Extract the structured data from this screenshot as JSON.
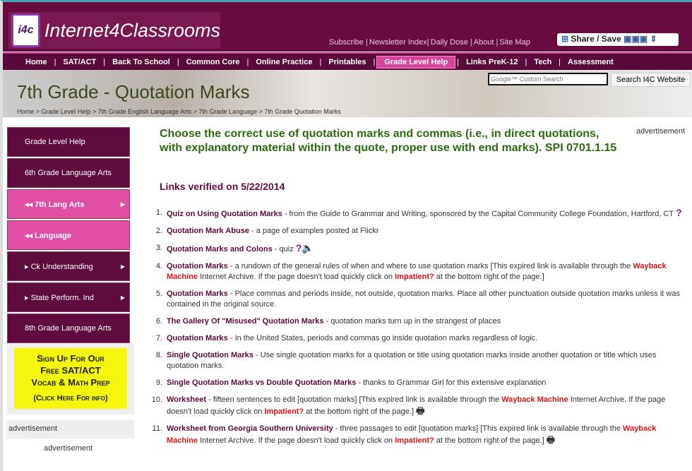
{
  "header": {
    "logo_badge": "i4c",
    "logo_text": "Internet4Classrooms",
    "top_links": [
      "Subscribe |",
      "Newsletter Index|",
      "Daily Dose |",
      "About |",
      "Site Map"
    ],
    "share_label": "Share / Save"
  },
  "nav": [
    {
      "label": "Home"
    },
    {
      "label": "SAT/ACT"
    },
    {
      "label": "Back To School"
    },
    {
      "label": "Common Core"
    },
    {
      "label": "Online Practice"
    },
    {
      "label": "Printables"
    },
    {
      "label": "Grade Level Help",
      "active": true
    },
    {
      "label": "Links PreK-12"
    },
    {
      "label": "Tech"
    },
    {
      "label": "Assessment"
    }
  ],
  "banner": {
    "title": "7th Grade - Quotation Marks",
    "breadcrumb": "Home > Grade Level Help > 7th Grade English Language Arts > 7th Grade Language > 7th Grade Quotation Marks",
    "search_placeholder": "Google™ Custom Search",
    "search_button": "Search I4C Website"
  },
  "sidebar": [
    {
      "label": "Grade Level Help"
    },
    {
      "label": "6th Grade Language Arts"
    },
    {
      "label": "◂◂ 7th Lang Arts",
      "pink": true,
      "arrow": true
    },
    {
      "label": "◂◂ Language",
      "pink": true
    },
    {
      "label": "▸  Ck Understanding",
      "arrow": true
    },
    {
      "label": "▸  State Perform. Ind",
      "arrow": true
    },
    {
      "label": "8th Grade Language Arts"
    }
  ],
  "promo": {
    "line1": "Sign Up For Our",
    "line2": "Free SAT/ACT",
    "line3": "Vocab & Math Prep",
    "line4": "(Click Here For info)"
  },
  "ads": {
    "a1": "advertisement",
    "a2": "advertisement",
    "a3": "advertisement"
  },
  "main": {
    "heading": "Choose the correct use of quotation marks and commas (i.e., in direct quotations, with explanatory material within the quote, proper use with end marks). SPI 0701.1.15",
    "verified": "Links verified on 5/22/2014",
    "items": [
      {
        "num": "1.",
        "parts": [
          {
            "t": "lk",
            "v": "Quiz on Using Quotation Marks"
          },
          {
            "t": "txt",
            "v": " - from the Guide to Grammar and Writing, sponsored by the Capital Community College Foundation, Hartford, CT "
          },
          {
            "t": "q",
            "v": "?"
          }
        ]
      },
      {
        "num": "2.",
        "parts": [
          {
            "t": "lk",
            "v": "Quotation Mark Abuse"
          },
          {
            "t": "txt",
            "v": " - a page of examples posted at Flickr"
          }
        ]
      },
      {
        "num": "3.",
        "parts": [
          {
            "t": "lk",
            "v": "Quotation Marks and Colons"
          },
          {
            "t": "txt",
            "v": " - quiz "
          },
          {
            "t": "q",
            "v": "?"
          },
          {
            "t": "spk",
            "v": "🔈"
          }
        ]
      },
      {
        "num": "4.",
        "parts": [
          {
            "t": "lk",
            "v": "Quotation Marks"
          },
          {
            "t": "txt",
            "v": " - a rundown of the general rules of when and where to use quotation marks [This expired link is available through the "
          },
          {
            "t": "red",
            "v": "Wayback Machine"
          },
          {
            "t": "txt",
            "v": " Internet Archive. If the page doesn't load quickly click on "
          },
          {
            "t": "red",
            "v": "Impatient?"
          },
          {
            "t": "txt",
            "v": " at the bottom right of the page.]"
          }
        ]
      },
      {
        "num": "5.",
        "parts": [
          {
            "t": "lk",
            "v": "Quotation Marks"
          },
          {
            "t": "txt",
            "v": " - Place commas and periods inside, not outside, quotation marks. Place all other punctuation outside quotation marks unless it was contained in the original source."
          }
        ]
      },
      {
        "num": "6.",
        "parts": [
          {
            "t": "lk",
            "v": "The Gallery Of \"Misused\" Quotation Marks"
          },
          {
            "t": "txt",
            "v": " - quotation marks turn up in the strangest of places"
          }
        ]
      },
      {
        "num": "7.",
        "parts": [
          {
            "t": "lk",
            "v": "Quotation Marks"
          },
          {
            "t": "txt",
            "v": " - In the United States, periods and commas go inside quotation marks regardless of logic."
          }
        ]
      },
      {
        "num": "8.",
        "parts": [
          {
            "t": "lk",
            "v": "Single Quotation Marks"
          },
          {
            "t": "txt",
            "v": " - Use single quotation marks for a quotation or title using quotation marks inside another quotation or title which uses quotation marks."
          }
        ]
      },
      {
        "num": "9.",
        "parts": [
          {
            "t": "lk",
            "v": "Single Quotation Marks vs Double Quotation Marks"
          },
          {
            "t": "txt",
            "v": " - thanks to Grammar Girl for this extensive explanation"
          }
        ]
      },
      {
        "num": "10.",
        "parts": [
          {
            "t": "lk",
            "v": "Worksheet"
          },
          {
            "t": "txt",
            "v": " - fifteen sentences to edit [quotation marks] [This expired link is available through the "
          },
          {
            "t": "red",
            "v": "Wayback Machine"
          },
          {
            "t": "txt",
            "v": " Internet Archive. If the page doesn't load quickly click on "
          },
          {
            "t": "red",
            "v": "Impatient?"
          },
          {
            "t": "txt",
            "v": " at the bottom right of the page.] "
          },
          {
            "t": "prn",
            "v": "🖶"
          }
        ]
      },
      {
        "num": "11.",
        "parts": [
          {
            "t": "lk",
            "v": "Worksheet from Georgia Southern University"
          },
          {
            "t": "txt",
            "v": " - three passages to edit [quotation marks] [This expired link is available through the "
          },
          {
            "t": "red",
            "v": "Wayback Machine"
          },
          {
            "t": "txt",
            "v": " Internet Archive. If the page doesn't load quickly click on "
          },
          {
            "t": "red",
            "v": "Impatient?"
          },
          {
            "t": "txt",
            "v": " at the bottom right of the page.] "
          },
          {
            "t": "prn",
            "v": "🖶"
          }
        ]
      }
    ]
  }
}
